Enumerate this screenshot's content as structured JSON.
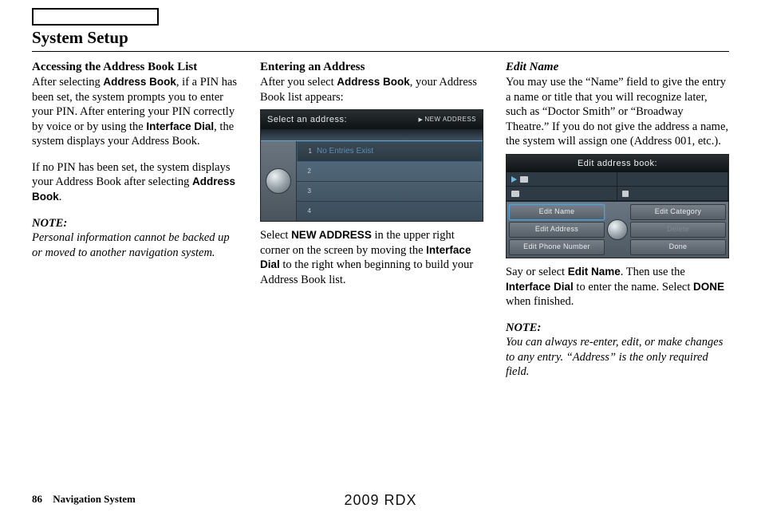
{
  "title": "System Setup",
  "col1": {
    "heading": "Accessing the Address Book List",
    "p1a": "After selecting ",
    "p1b": ", if a PIN has been set, the system prompts you to enter your PIN. After entering your PIN correctly by voice or by using the ",
    "p1c": ", the system displays your Address Book.",
    "bold1": "Address Book",
    "bold2": "Interface Dial",
    "p2a": "If no PIN has been set, the system displays your Address Book after selecting ",
    "p2b": ".",
    "note_label": "NOTE:",
    "note_body": "Personal information cannot be backed up or moved to another navigation system."
  },
  "col2": {
    "heading": "Entering an Address",
    "p1a": "After you select ",
    "p1b": ", your Address Book list appears:",
    "bold1": "Address Book",
    "screen": {
      "title": "Select an address:",
      "new": "NEW ADDRESS",
      "row1": "No Entries Exist",
      "nums": [
        "1",
        "2",
        "3",
        "4"
      ]
    },
    "p2a": "Select ",
    "p2b": " in the upper right corner on the screen by moving the ",
    "p2c": " to the right when beginning to build your Address Book list.",
    "bold2": "NEW ADDRESS",
    "bold3": "Interface Dial"
  },
  "col3": {
    "heading": "Edit Name",
    "p1": "You may use the “Name” field to give the entry a name or title that you will recognize later, such as “Doctor Smith” or “Broadway Theatre.” If you do not give the address a name, the system will assign one (Address 001, etc.).",
    "screen": {
      "title": "Edit address book:",
      "btn_edit_name": "Edit Name",
      "btn_edit_category": "Edit Category",
      "btn_edit_address": "Edit Address",
      "btn_delete": "Delete",
      "btn_edit_phone": "Edit Phone Number",
      "btn_done": "Done"
    },
    "p2a": "Say or select ",
    "p2b": ". Then use the ",
    "p2c": " to enter the name. Select ",
    "p2d": " when finished.",
    "bold1": "Edit Name",
    "bold2": "Interface Dial",
    "bold3": "DONE",
    "note_label": "NOTE:",
    "note_body": "You can always re-enter, edit, or make changes to any entry. “Address” is the only required field."
  },
  "footer": {
    "page": "86",
    "section": "Navigation System",
    "model": "2009  RDX"
  }
}
